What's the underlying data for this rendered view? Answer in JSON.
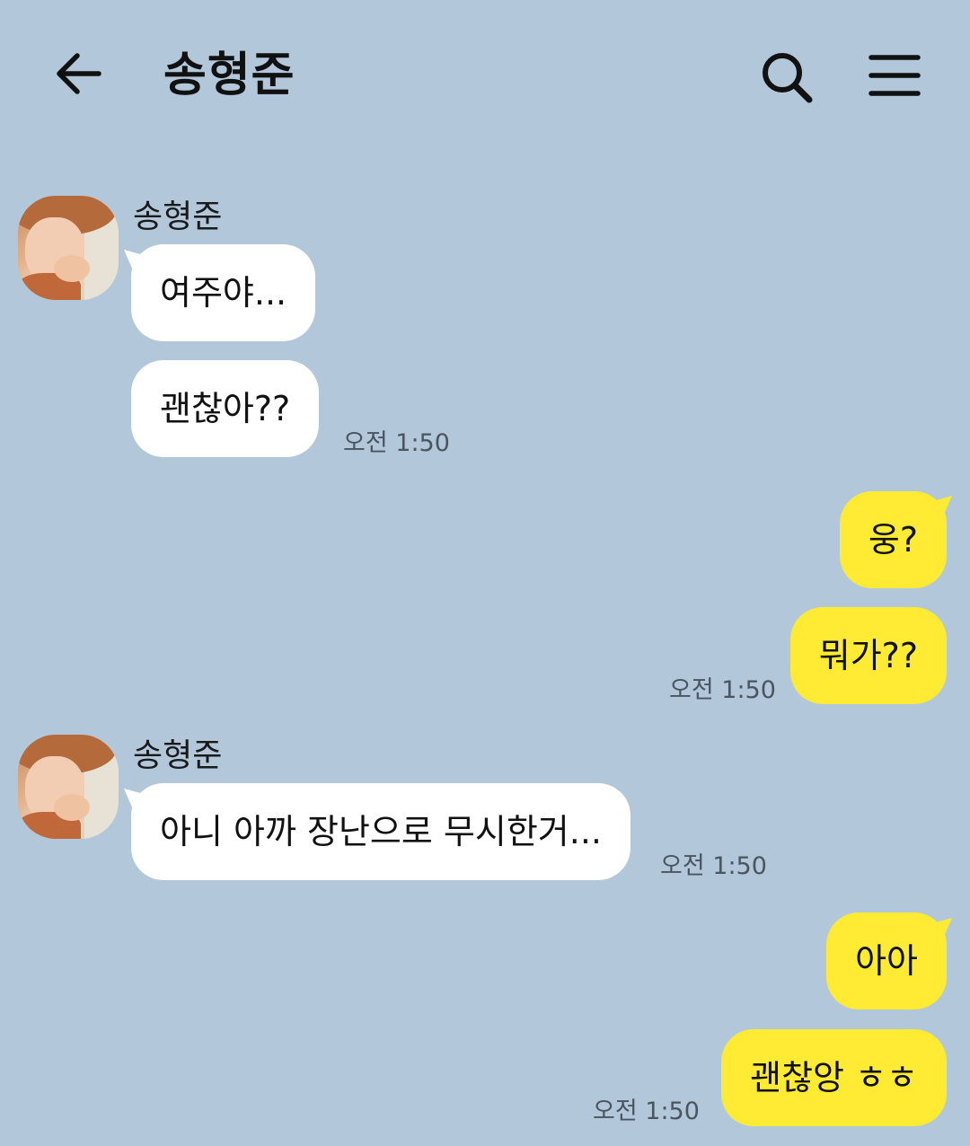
{
  "header": {
    "title": "송형준",
    "back_icon": "arrow-left-icon",
    "search_icon": "search-icon",
    "menu_icon": "hamburger-menu-icon"
  },
  "colors": {
    "background": "#b2c7d9",
    "incoming_bubble": "#ffffff",
    "outgoing_bubble": "#ffeb33"
  },
  "messages": {
    "group1": {
      "sender": "송형준",
      "bubble1": "여주야...",
      "bubble2": "괜찮아??",
      "time": "오전 1:50"
    },
    "group2": {
      "bubble1": "웅?",
      "bubble2": "뭐가??",
      "time": "오전 1:50"
    },
    "group3": {
      "sender": "송형준",
      "bubble1": "아니 아까 장난으로 무시한거...",
      "time": "오전 1:50"
    },
    "group4": {
      "bubble1": "아아",
      "bubble2": "괜찮앙 ㅎㅎ",
      "time": "오전 1:50"
    }
  }
}
